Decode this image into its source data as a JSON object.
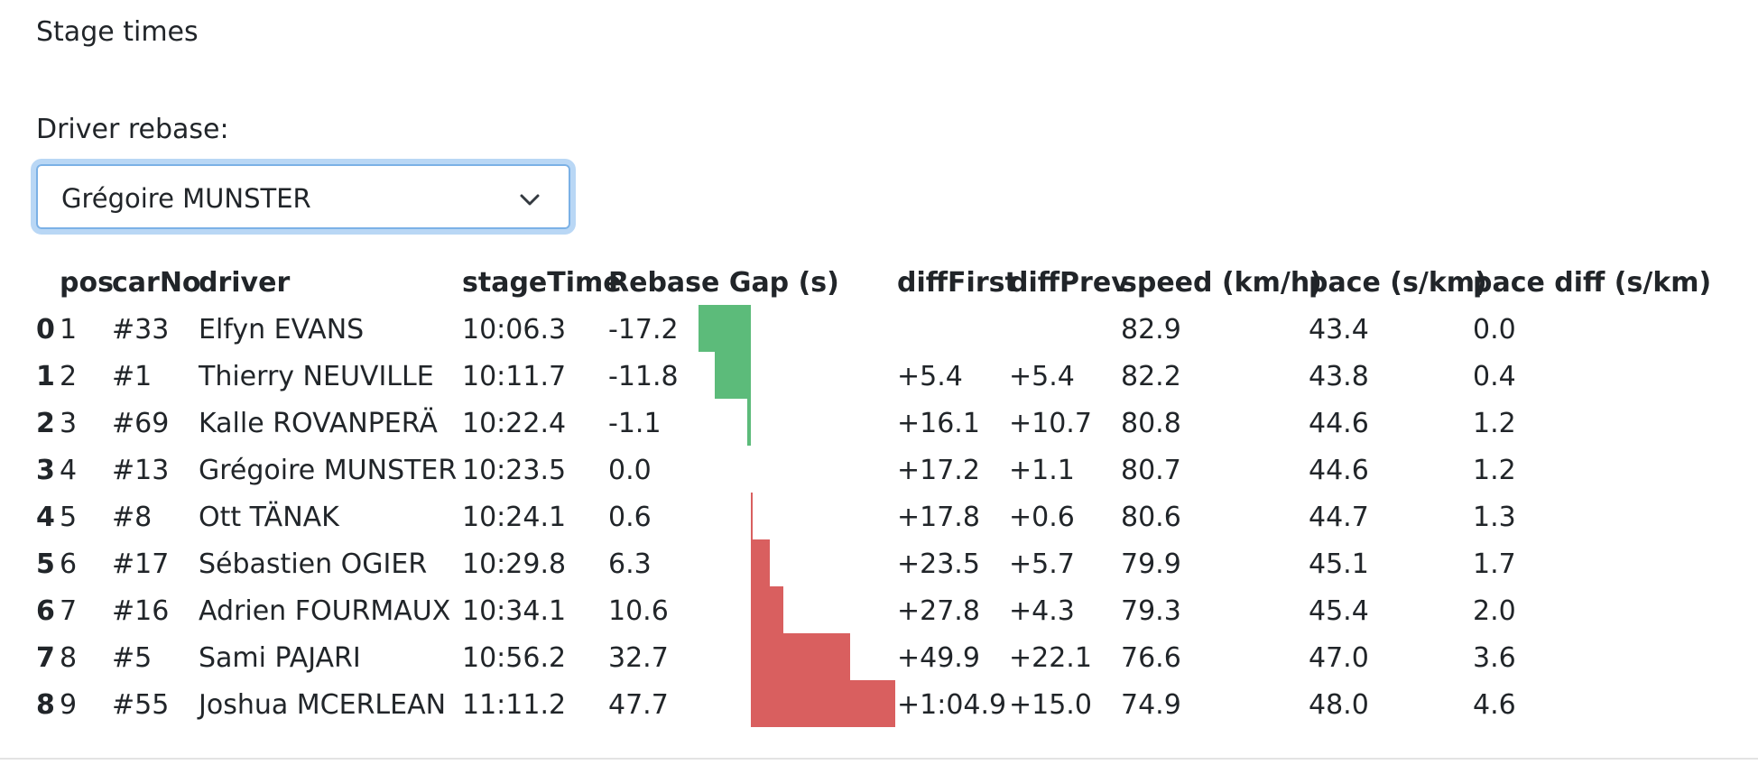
{
  "heading": "Stage times",
  "rebase": {
    "label": "Driver rebase:",
    "selected": "Grégoire MUNSTER",
    "icon": "chevron-down-icon"
  },
  "colors": {
    "negative_bar": "#5cbb7a",
    "positive_bar": "#d95f5f"
  },
  "table": {
    "columns": [
      "pos",
      "carNo",
      "driver",
      "stageTime",
      "Rebase Gap (s)",
      "diffFirst",
      "diffPrev",
      "speed (km/h)",
      "pace (s/km)",
      "pace diff (s/km)"
    ],
    "rows": [
      {
        "index": "0",
        "pos": "1",
        "carNo": "#33",
        "driver": "Elfyn EVANS",
        "stageTime": "10:06.3",
        "gap": "-17.2",
        "gap_value": -17.2,
        "diffFirst": "",
        "diffPrev": "",
        "speed": "82.9",
        "pace": "43.4",
        "paceDiff": "0.0"
      },
      {
        "index": "1",
        "pos": "2",
        "carNo": "#1",
        "driver": "Thierry NEUVILLE",
        "stageTime": "10:11.7",
        "gap": "-11.8",
        "gap_value": -11.8,
        "diffFirst": "+5.4",
        "diffPrev": "+5.4",
        "speed": "82.2",
        "pace": "43.8",
        "paceDiff": "0.4"
      },
      {
        "index": "2",
        "pos": "3",
        "carNo": "#69",
        "driver": "Kalle ROVANPERÄ",
        "stageTime": "10:22.4",
        "gap": "-1.1",
        "gap_value": -1.1,
        "diffFirst": "+16.1",
        "diffPrev": "+10.7",
        "speed": "80.8",
        "pace": "44.6",
        "paceDiff": "1.2"
      },
      {
        "index": "3",
        "pos": "4",
        "carNo": "#13",
        "driver": "Grégoire MUNSTER",
        "stageTime": "10:23.5",
        "gap": "0.0",
        "gap_value": 0.0,
        "diffFirst": "+17.2",
        "diffPrev": "+1.1",
        "speed": "80.7",
        "pace": "44.6",
        "paceDiff": "1.2"
      },
      {
        "index": "4",
        "pos": "5",
        "carNo": "#8",
        "driver": "Ott TÄNAK",
        "stageTime": "10:24.1",
        "gap": "0.6",
        "gap_value": 0.6,
        "diffFirst": "+17.8",
        "diffPrev": "+0.6",
        "speed": "80.6",
        "pace": "44.7",
        "paceDiff": "1.3"
      },
      {
        "index": "5",
        "pos": "6",
        "carNo": "#17",
        "driver": "Sébastien OGIER",
        "stageTime": "10:29.8",
        "gap": "6.3",
        "gap_value": 6.3,
        "diffFirst": "+23.5",
        "diffPrev": "+5.7",
        "speed": "79.9",
        "pace": "45.1",
        "paceDiff": "1.7"
      },
      {
        "index": "6",
        "pos": "7",
        "carNo": "#16",
        "driver": "Adrien FOURMAUX",
        "stageTime": "10:34.1",
        "gap": "10.6",
        "gap_value": 10.6,
        "diffFirst": "+27.8",
        "diffPrev": "+4.3",
        "speed": "79.3",
        "pace": "45.4",
        "paceDiff": "2.0"
      },
      {
        "index": "7",
        "pos": "8",
        "carNo": "#5",
        "driver": "Sami PAJARI",
        "stageTime": "10:56.2",
        "gap": "32.7",
        "gap_value": 32.7,
        "diffFirst": "+49.9",
        "diffPrev": "+22.1",
        "speed": "76.6",
        "pace": "47.0",
        "paceDiff": "3.6"
      },
      {
        "index": "8",
        "pos": "9",
        "carNo": "#55",
        "driver": "Joshua MCERLEAN",
        "stageTime": "11:11.2",
        "gap": "47.7",
        "gap_value": 47.7,
        "diffFirst": "+1:04.9",
        "diffPrev": "+15.0",
        "speed": "74.9",
        "pace": "48.0",
        "paceDiff": "4.6"
      }
    ]
  }
}
